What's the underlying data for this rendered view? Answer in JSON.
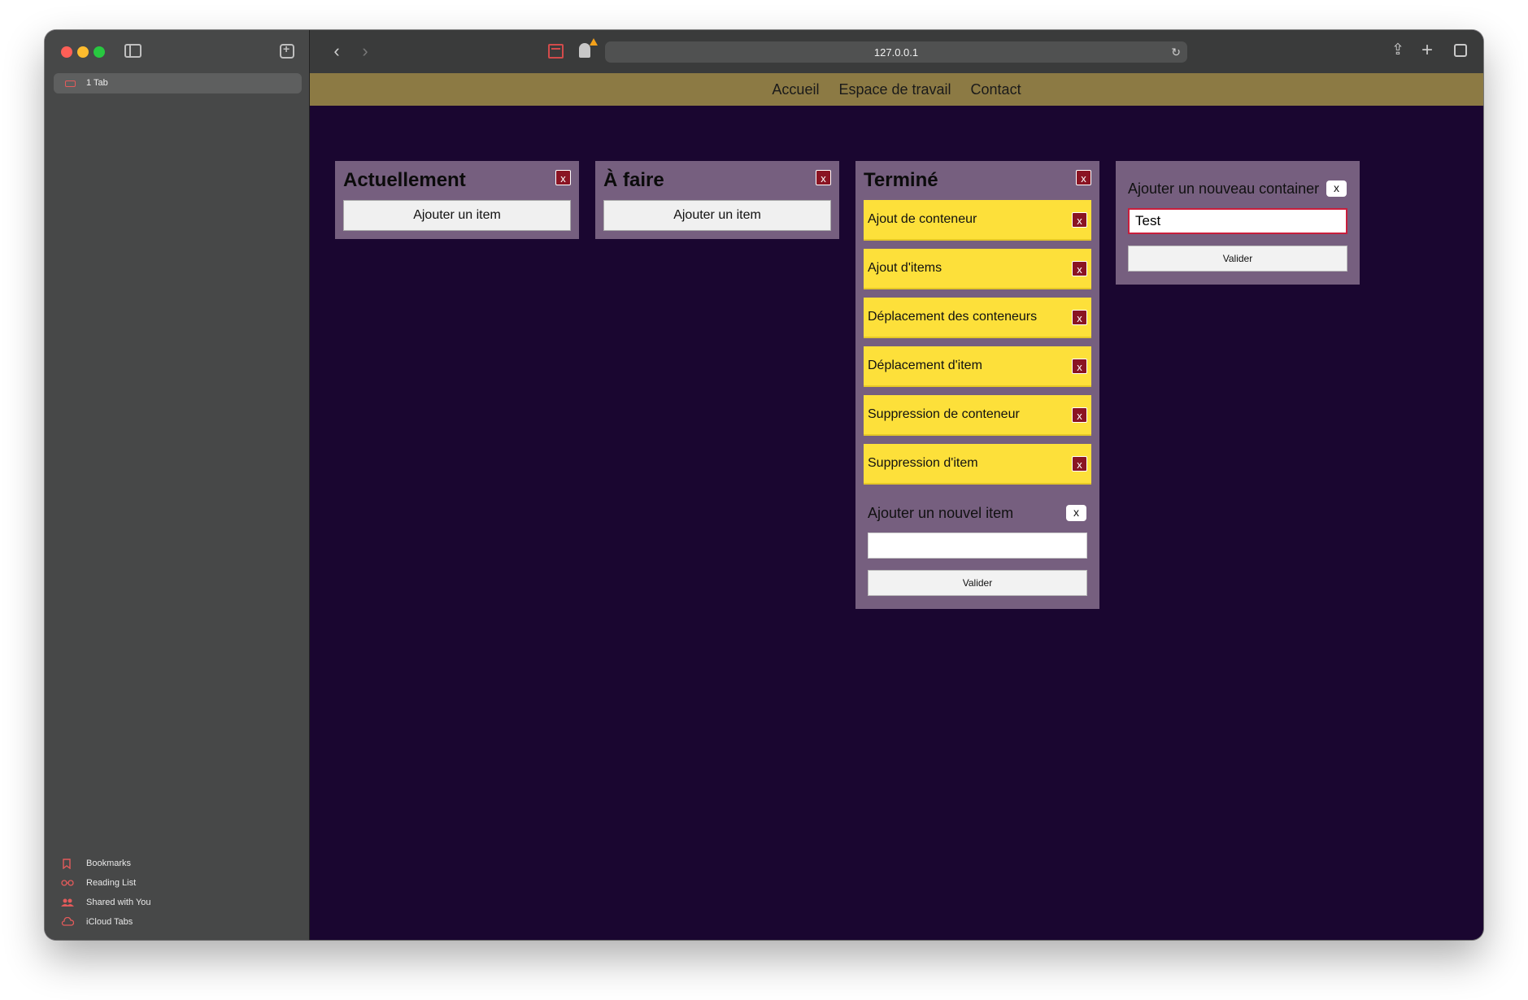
{
  "sidebar": {
    "tab_label": "1 Tab",
    "links": [
      {
        "label": "Bookmarks",
        "icon": "bookmark-icon"
      },
      {
        "label": "Reading List",
        "icon": "glasses-icon"
      },
      {
        "label": "Shared with You",
        "icon": "shared-icon"
      },
      {
        "label": "iCloud Tabs",
        "icon": "cloud-icon"
      }
    ]
  },
  "toolbar": {
    "url": "127.0.0.1"
  },
  "nav": {
    "links": [
      "Accueil",
      "Espace de travail",
      "Contact"
    ]
  },
  "containers": [
    {
      "title": "Actuellement",
      "close": "x",
      "add_label": "Ajouter un item"
    },
    {
      "title": "À faire",
      "close": "x",
      "add_label": "Ajouter un item"
    },
    {
      "title": "Terminé",
      "close": "x",
      "items": [
        "Ajout de conteneur",
        "Ajout d'items",
        "Déplacement des conteneurs",
        "Déplacement d'item",
        "Suppression de conteneur",
        "Suppression d'item"
      ],
      "item_close": "x",
      "new_item_form": {
        "title": "Ajouter un nouvel item",
        "close": "x",
        "value": "",
        "submit": "Valider"
      }
    }
  ],
  "new_container_form": {
    "title": "Ajouter un nouveau container",
    "close": "x",
    "value": "Test",
    "submit": "Valider"
  },
  "colors": {
    "page_bg": "#1a0630",
    "navbar_bg": "#8c7a44",
    "container_bg": "#765f7f",
    "item_bg": "#fde03a",
    "close_btn": "#8a1423"
  }
}
